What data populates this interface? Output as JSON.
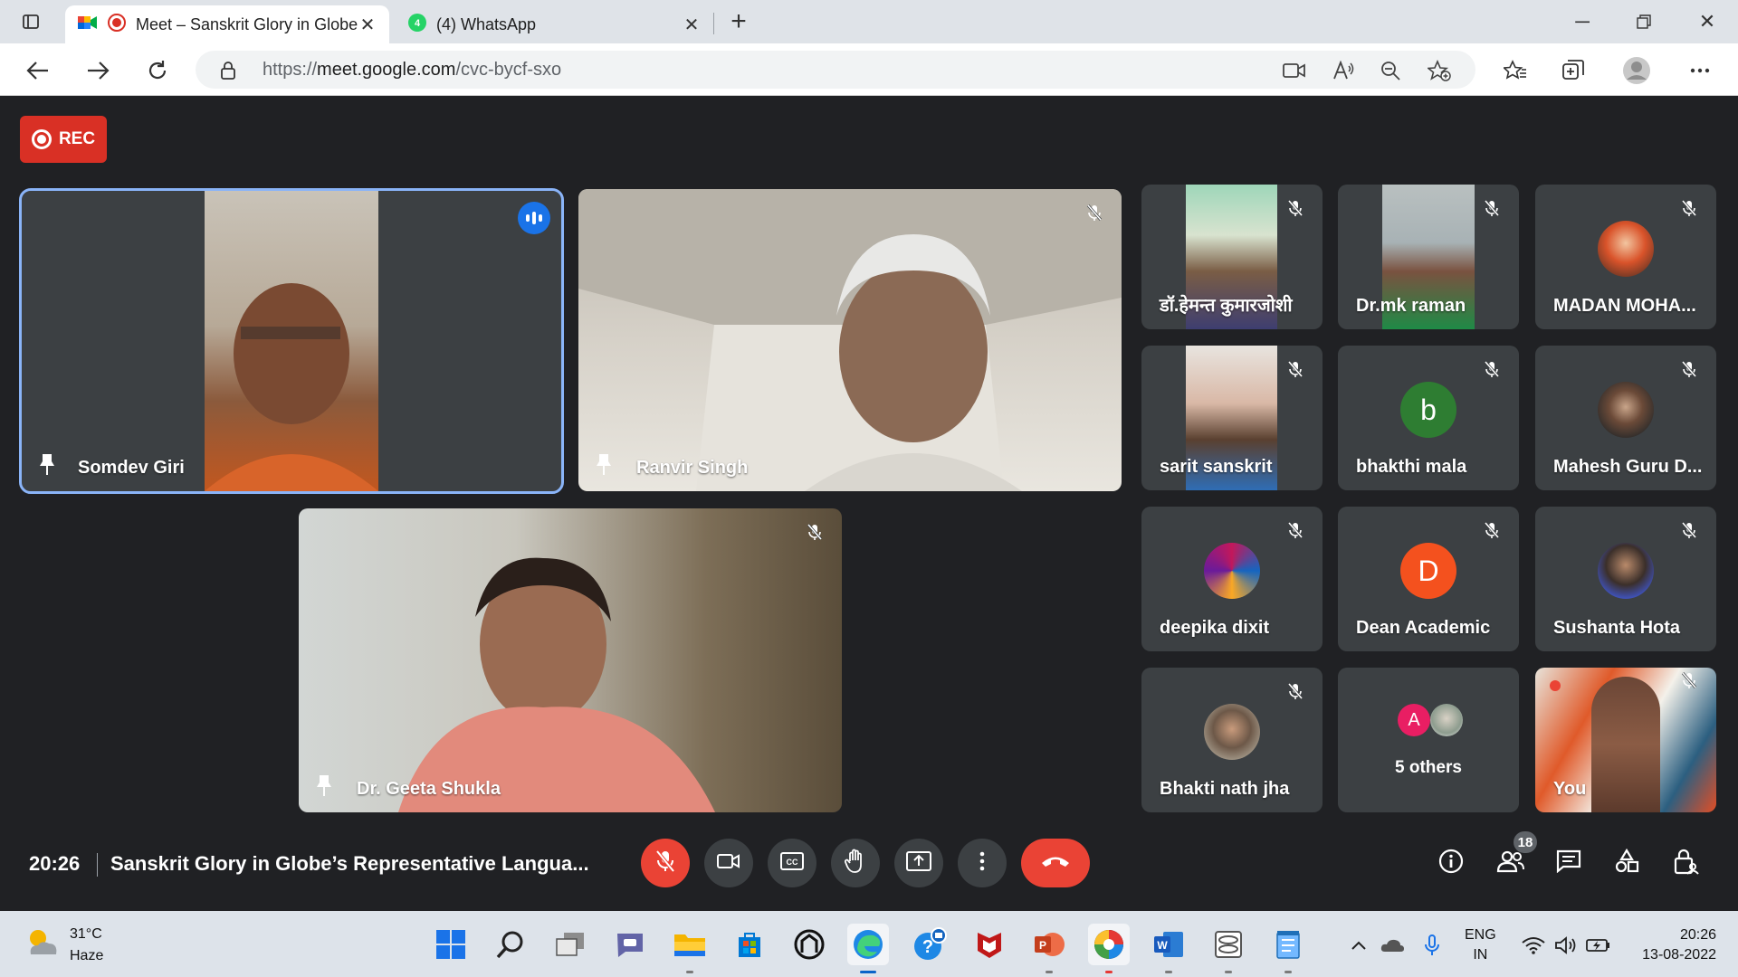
{
  "browser": {
    "tabs": [
      {
        "title": "Meet – Sanskrit Glory in Globe's Representative Language",
        "active": true
      },
      {
        "title": "(4) WhatsApp",
        "active": false
      }
    ],
    "url_prefix": "https://",
    "url_host": "meet.google.com",
    "url_path": "/cvc-bycf-sxo"
  },
  "meet": {
    "rec_label": "REC",
    "main_tiles": [
      {
        "name": "Somdev Giri",
        "speaking": true,
        "pinned": true
      },
      {
        "name": "Ranvir Singh",
        "muted": true,
        "pinned": true
      },
      {
        "name": "Dr. Geeta Shukla",
        "muted": true,
        "pinned": true
      }
    ],
    "grid_tiles": [
      {
        "name": "डॉ.हेमन्त कुमारजोशी",
        "muted": true,
        "kind": "video"
      },
      {
        "name": "Dr.mk raman",
        "muted": true,
        "kind": "video"
      },
      {
        "name": "MADAN MOHA...",
        "muted": true,
        "kind": "photo"
      },
      {
        "name": "sarit sanskrit",
        "muted": true,
        "kind": "video"
      },
      {
        "name": "bhakthi mala",
        "muted": true,
        "kind": "letter",
        "letter": "b",
        "color": "#2e7d32"
      },
      {
        "name": "Mahesh Guru D...",
        "muted": true,
        "kind": "photo"
      },
      {
        "name": "deepika dixit",
        "muted": true,
        "kind": "photo"
      },
      {
        "name": "Dean Academic",
        "muted": true,
        "kind": "letter",
        "letter": "D",
        "color": "#f4511e"
      },
      {
        "name": "Sushanta Hota",
        "muted": true,
        "kind": "photo"
      },
      {
        "name": "Bhakti nath jha",
        "muted": true,
        "kind": "photo"
      },
      {
        "name": "5 others",
        "kind": "others",
        "letter": "A",
        "color": "#e91e63"
      },
      {
        "name": "You",
        "muted": true,
        "kind": "self"
      }
    ],
    "time": "20:26",
    "title": "Sanskrit Glory in Globe’s Representative Langua...",
    "participants_count": "18"
  },
  "taskbar": {
    "temperature": "31°C",
    "condition": "Haze",
    "lang_top": "ENG",
    "lang_bottom": "IN",
    "clock_time": "20:26",
    "clock_date": "13-08-2022"
  }
}
